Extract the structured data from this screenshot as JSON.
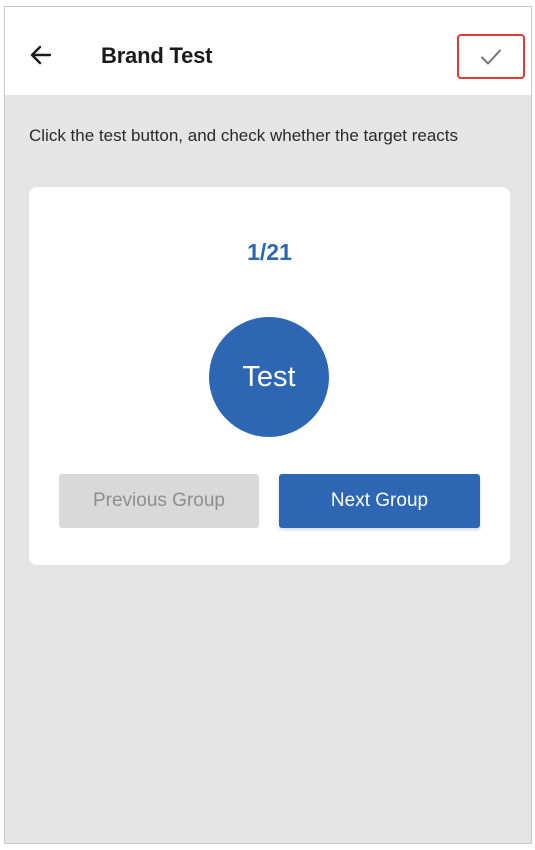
{
  "header": {
    "title": "Brand Test",
    "back_icon": "arrow-left-icon",
    "confirm_icon": "checkmark-icon",
    "confirm_highlight_color": "#e53935"
  },
  "instruction": "Click the test button, and check whether the target reacts",
  "test_card": {
    "counter": "1/21",
    "test_button_label": "Test",
    "previous_group_label": "Previous Group",
    "next_group_label": "Next Group"
  },
  "colors": {
    "accent": "#2d67b3",
    "background": "#e5e5e5",
    "disabled_button": "#d9d9d9",
    "disabled_text": "#8e8e8e"
  }
}
